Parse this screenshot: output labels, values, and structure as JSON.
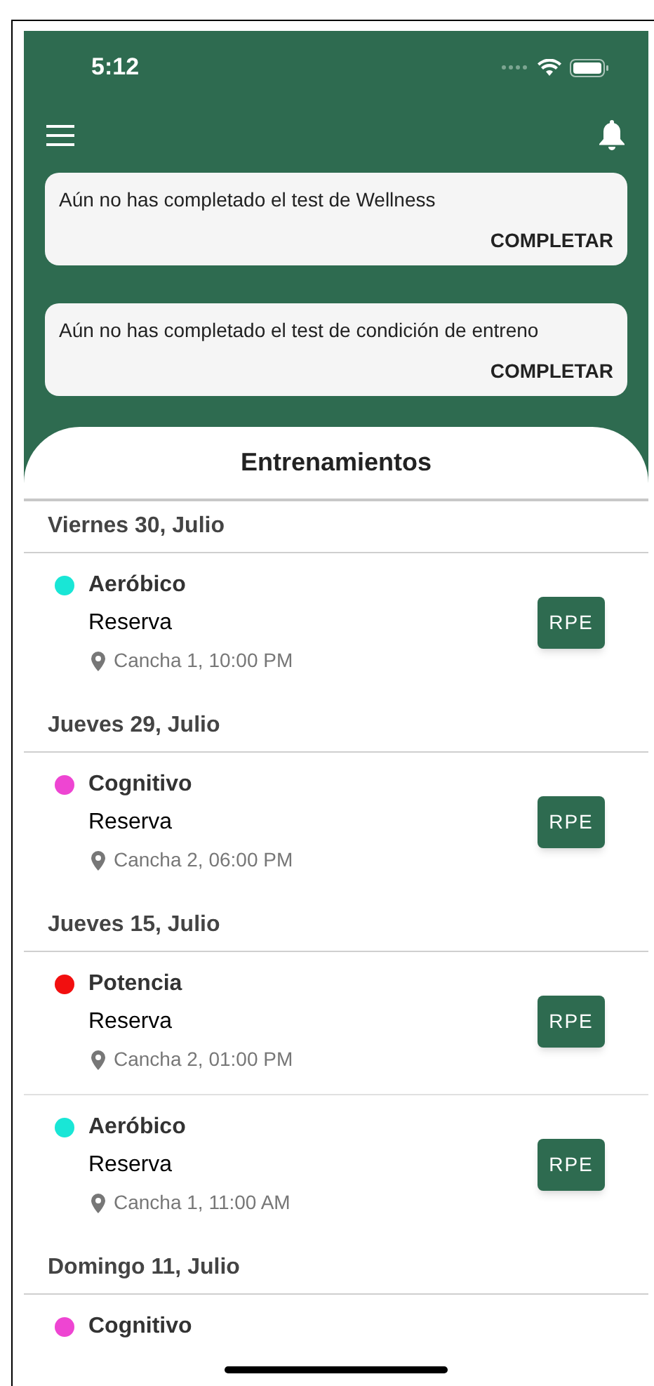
{
  "status_bar": {
    "time": "5:12"
  },
  "alerts": [
    {
      "message": "Aún no has completado el test de Wellness",
      "action": "COMPLETAR"
    },
    {
      "message": "Aún no has completado el test de condición de entreno",
      "action": "COMPLETAR"
    }
  ],
  "sheet": {
    "title": "Entrenamientos"
  },
  "days": [
    {
      "date": "Viernes 30, Julio",
      "sessions": [
        {
          "name": "Aeróbico",
          "color": "#19e6d6",
          "subtitle": "Reserva",
          "place": "Cancha 1, 10:00 PM",
          "button": "RPE"
        }
      ]
    },
    {
      "date": "Jueves 29, Julio",
      "sessions": [
        {
          "name": "Cognitivo",
          "color": "#ee45d2",
          "subtitle": "Reserva",
          "place": "Cancha 2, 06:00 PM",
          "button": "RPE"
        }
      ]
    },
    {
      "date": "Jueves 15, Julio",
      "sessions": [
        {
          "name": "Potencia",
          "color": "#f20f0f",
          "subtitle": "Reserva",
          "place": "Cancha 2, 01:00 PM",
          "button": "RPE"
        },
        {
          "name": "Aeróbico",
          "color": "#19e6d6",
          "subtitle": "Reserva",
          "place": "Cancha 1, 11:00 AM",
          "button": "RPE"
        }
      ]
    },
    {
      "date": "Domingo 11, Julio",
      "sessions": [
        {
          "name": "Cognitivo",
          "color": "#ee45d2"
        }
      ]
    }
  ]
}
